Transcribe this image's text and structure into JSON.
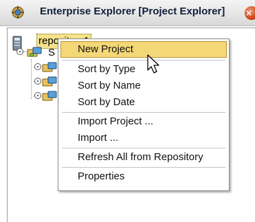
{
  "window": {
    "title": "Enterprise Explorer [Project Explorer]",
    "close_glyph": "×",
    "title_icon": "explorer-icon",
    "close_icon": "close-icon"
  },
  "tree": {
    "root_label": "repository1",
    "child_label_partial": "S",
    "root_icon": "repository-icon",
    "node_icon": "project-node-icon"
  },
  "context_menu": {
    "items": [
      {
        "label": "New Project",
        "highlighted": true
      },
      {
        "label": "Sort by Type"
      },
      {
        "label": "Sort by Name"
      },
      {
        "label": "Sort by Date"
      },
      {
        "label": "Import Project ..."
      },
      {
        "label": "Import ..."
      },
      {
        "label": "Refresh All from Repository"
      },
      {
        "label": "Properties"
      }
    ]
  },
  "colors": {
    "highlight": "#f4d877",
    "selection": "#f6e28a",
    "title_text": "#0f1f3a",
    "close_button": "#d24a1e"
  }
}
